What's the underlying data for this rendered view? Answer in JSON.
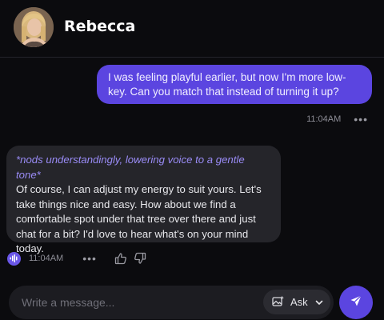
{
  "header": {
    "contact_name": "Rebecca",
    "avatar_icon": "profile-photo"
  },
  "messages": [
    {
      "sender": "user",
      "text": "I was feeling playful earlier, but now I'm more low-key. Can you match that instead of turning it up?",
      "time": "11:04AM",
      "menu_icon": "more-horizontal-icon"
    },
    {
      "sender": "assistant",
      "action": "*nods understandingly, lowering voice to a gentle tone*",
      "text": "Of course, I can adjust my energy to suit yours. Let's take things nice and easy. How about we find a comfortable spot under that tree over there and just chat for a bit? I'd love to hear what's on your mind today.",
      "time": "11:04AM",
      "icons": [
        "voice-playback-icon",
        "more-horizontal-icon",
        "thumbs-up-icon",
        "thumbs-down-icon"
      ]
    }
  ],
  "composer": {
    "placeholder": "Write a message...",
    "ask_label": "Ask",
    "icons": [
      "image-sparkle-icon",
      "chevron-down-icon",
      "send-icon"
    ]
  },
  "colors": {
    "background": "#0b0b0e",
    "accent": "#5b45e0",
    "assistant_bubble": "#25252a",
    "action_text": "#9a8cf7"
  }
}
